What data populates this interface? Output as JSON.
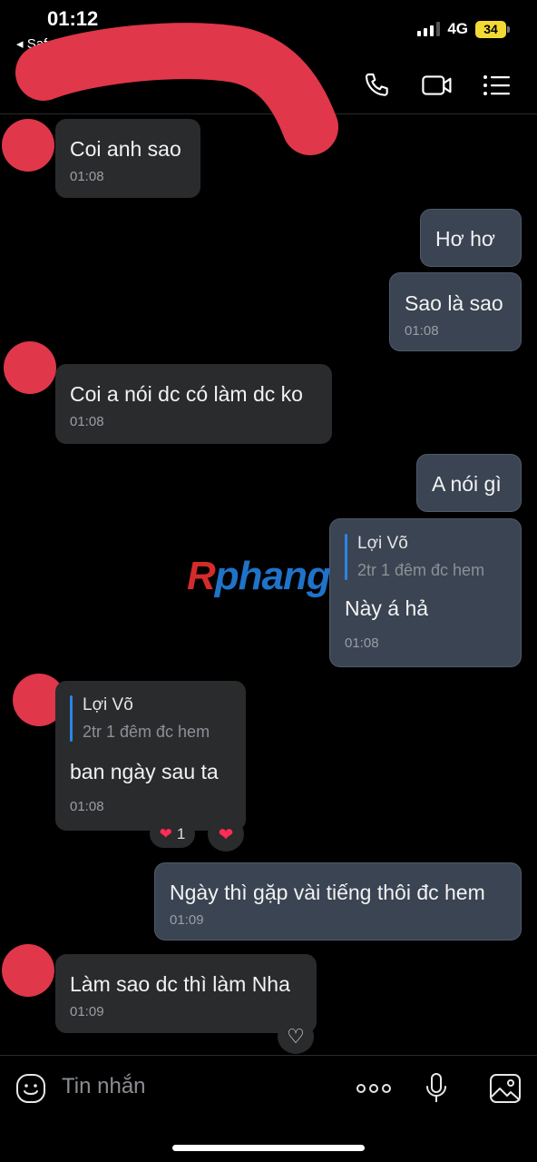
{
  "status": {
    "time": "01:12",
    "back_app": "◂ Safari",
    "network": "4G",
    "battery": "34"
  },
  "header": {
    "icons": [
      "phone-icon",
      "video-icon",
      "menu-icon"
    ]
  },
  "watermark": {
    "part1": "R",
    "part2": "phang"
  },
  "messages": [
    {
      "dir": "in",
      "text": "Coi anh sao",
      "time": "01:08"
    },
    {
      "dir": "out",
      "text": "Hơ hơ"
    },
    {
      "dir": "out",
      "text": "Sao là sao",
      "time": "01:08"
    },
    {
      "dir": "in",
      "text": "Coi a nói dc có làm dc ko",
      "time": "01:08"
    },
    {
      "dir": "out",
      "text": "A nói gì"
    },
    {
      "dir": "out",
      "quote_author": "Lợi Võ",
      "quote_text": "2tr 1 đêm đc hem",
      "text": "Này á hả",
      "time": "01:08"
    },
    {
      "dir": "in",
      "quote_author": "Lợi Võ",
      "quote_text": "2tr 1 đêm đc hem",
      "text": "ban ngày sau ta",
      "time": "01:08"
    },
    {
      "dir": "out",
      "text": "Ngày thì gặp vài tiếng thôi đc hem",
      "time": "01:09"
    },
    {
      "dir": "in",
      "text": "Làm sao dc thì làm Nha",
      "time": "01:09"
    }
  ],
  "reactions": {
    "heart_count": "1",
    "heart_glyph": "❤",
    "like_glyph": "♡"
  },
  "input": {
    "placeholder": "Tin nhắn",
    "icons": [
      "emoji-icon",
      "more-icon",
      "microphone-icon",
      "image-icon"
    ]
  },
  "colors": {
    "incoming_bubble": "#2a2b2d",
    "outgoing_bubble": "#3a4452",
    "avatar_redaction": "#e0374a",
    "quote_accent": "#2a86e8",
    "battery": "#f3d935"
  }
}
